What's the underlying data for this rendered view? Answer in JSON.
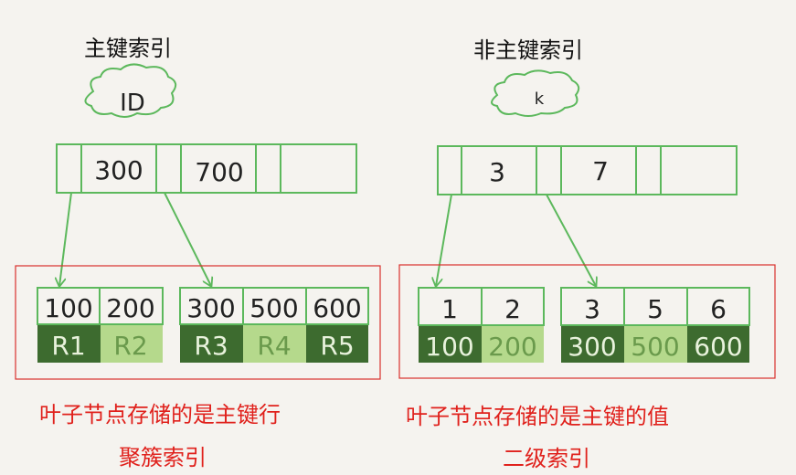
{
  "primary": {
    "title": "主键索引",
    "root_label": "ID",
    "root_keys": [
      "300",
      "700"
    ],
    "leaf_groups": [
      {
        "keys": [
          "100",
          "200"
        ],
        "values": [
          "R1",
          "R2"
        ]
      },
      {
        "keys": [
          "300",
          "500",
          "600"
        ],
        "values": [
          "R3",
          "R4",
          "R5"
        ]
      }
    ],
    "caption_line1": "叶子节点存储的是主键行",
    "caption_line2": "聚簇索引"
  },
  "secondary": {
    "title": "非主键索引",
    "root_label": "k",
    "root_keys": [
      "3",
      "7"
    ],
    "leaf_groups": [
      {
        "keys": [
          "1",
          "2"
        ],
        "values": [
          "100",
          "200"
        ]
      },
      {
        "keys": [
          "3",
          "5",
          "6"
        ],
        "values": [
          "300",
          "500",
          "600"
        ]
      }
    ],
    "caption_line1": "叶子节点存储的是主键的值",
    "caption_line2": "二级索引"
  },
  "colors": {
    "node_border": "#5cb85c",
    "dark_value": "#3d6b2f",
    "light_value": "#b5d98c",
    "highlight_box": "#d9302c",
    "arrow": "#5cb85c"
  }
}
